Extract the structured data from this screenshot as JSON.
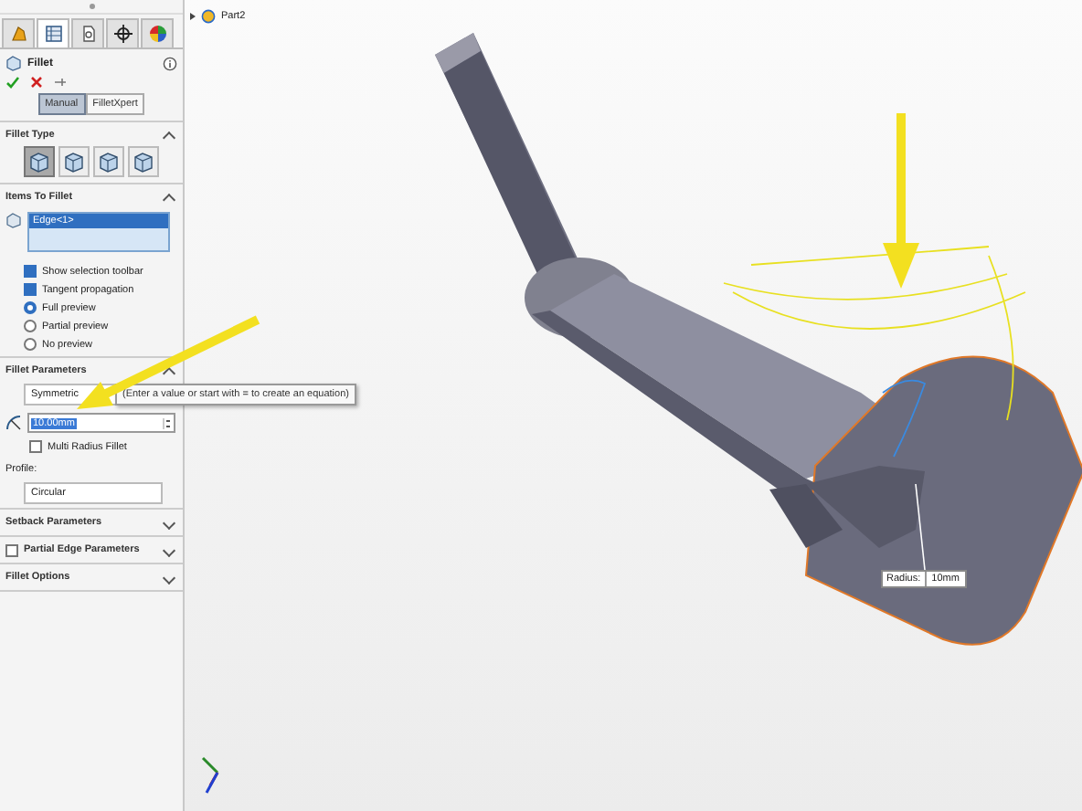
{
  "feature_tabs": [
    {
      "kind": "feature",
      "selected": false
    },
    {
      "kind": "property",
      "selected": true
    },
    {
      "kind": "config",
      "selected": false
    },
    {
      "kind": "origin",
      "selected": false
    },
    {
      "kind": "appearance",
      "selected": false
    }
  ],
  "panel_title": "Fillet",
  "mode_buttons": [
    {
      "label": "Manual",
      "selected": true
    },
    {
      "label": "FilletXpert",
      "selected": false
    }
  ],
  "fillet_type": {
    "title": "Fillet Type",
    "expanded": true,
    "types": [
      {
        "selected": true
      },
      {
        "selected": false
      },
      {
        "selected": false
      },
      {
        "selected": false
      }
    ]
  },
  "items_to_fillet": {
    "title": "Items To Fillet",
    "expanded": true,
    "selection": "Edge<1>",
    "options": [
      {
        "label": "Show selection toolbar",
        "kind": "checkbox",
        "checked": true
      },
      {
        "label": "Tangent propagation",
        "kind": "checkbox",
        "checked": true
      },
      {
        "label": "Full preview",
        "kind": "radio",
        "checked": true
      },
      {
        "label": "Partial preview",
        "kind": "radio",
        "checked": false
      },
      {
        "label": "No preview",
        "kind": "radio",
        "checked": false
      }
    ]
  },
  "fillet_parameters": {
    "title": "Fillet Parameters",
    "expanded": true,
    "method": "Symmetric",
    "tooltip": "(Enter a value or start with = to create an equation)",
    "radius": "10.00mm",
    "multi_radius": {
      "label": "Multi Radius Fillet",
      "checked": false
    },
    "profile_label": "Profile:",
    "profile": "Circular"
  },
  "collapsed_sections": [
    {
      "title": "Setback Parameters",
      "kind": "plain",
      "expanded": false
    },
    {
      "title": "Partial Edge Parameters",
      "kind": "checkbox",
      "checked": false,
      "expanded": false
    },
    {
      "title": "Fillet Options",
      "kind": "plain",
      "expanded": false
    }
  ],
  "tree": {
    "part": "Part2"
  },
  "callout": {
    "label": "Radius:",
    "value": "10mm"
  }
}
